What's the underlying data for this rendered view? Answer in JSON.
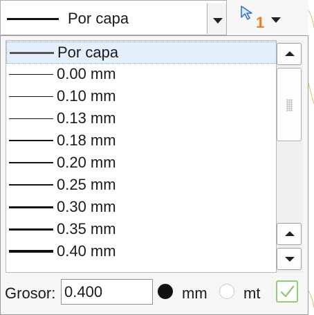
{
  "combo": {
    "selected_label": "Por capa"
  },
  "select_tool": {
    "count": "1"
  },
  "list": {
    "items": [
      {
        "label": "Por capa",
        "weight": 3,
        "selected": true
      },
      {
        "label": "0.00 mm",
        "weight": 1,
        "selected": false
      },
      {
        "label": "0.10 mm",
        "weight": 1,
        "selected": false
      },
      {
        "label": "0.13 mm",
        "weight": 1,
        "selected": false
      },
      {
        "label": "0.18 mm",
        "weight": 2,
        "selected": false
      },
      {
        "label": "0.20 mm",
        "weight": 2,
        "selected": false
      },
      {
        "label": "0.25 mm",
        "weight": 2,
        "selected": false
      },
      {
        "label": "0.30 mm",
        "weight": 3,
        "selected": false
      },
      {
        "label": "0.35 mm",
        "weight": 3,
        "selected": false
      },
      {
        "label": "0.40 mm",
        "weight": 4,
        "selected": false
      }
    ]
  },
  "footer": {
    "grosor_label": "Grosor:",
    "grosor_value": "0.400",
    "unit_mm_label": "mm",
    "unit_mt_label": "mt",
    "unit_selected": "mm"
  },
  "colors": {
    "accent_orange": "#f07a1e",
    "ok_green": "#8fcf74",
    "selection_bg": "#e3f0fc"
  }
}
